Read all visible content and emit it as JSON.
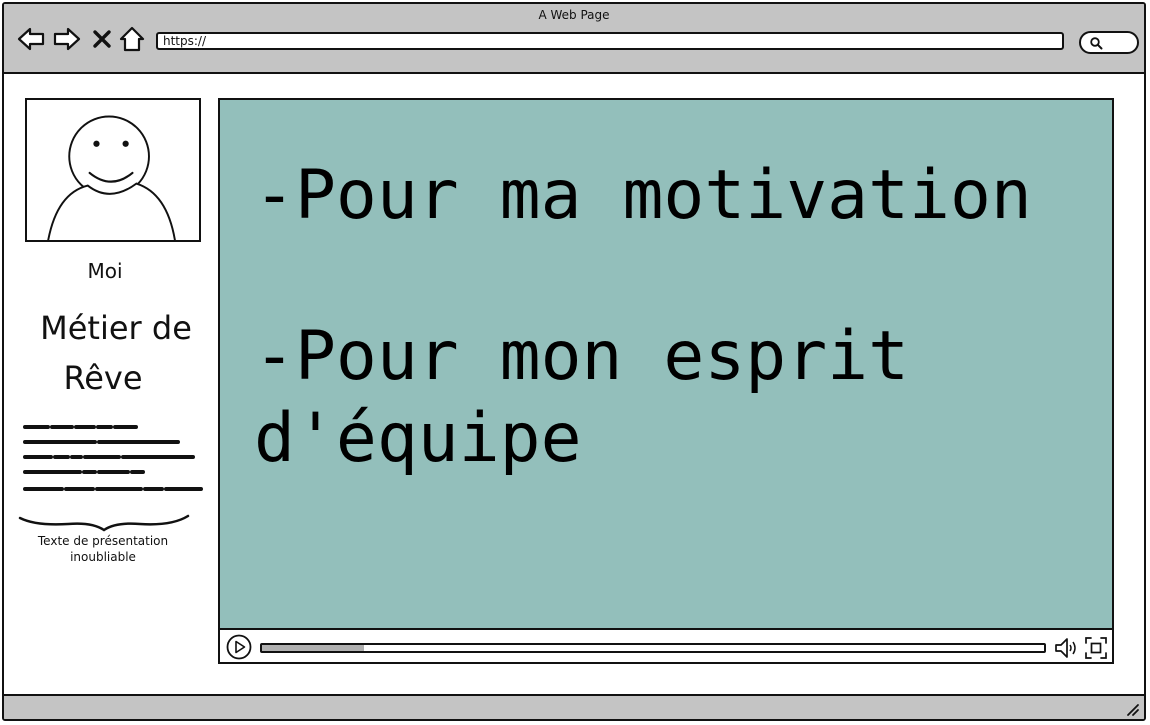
{
  "window": {
    "title": "A Web Page"
  },
  "browser": {
    "url": "https://",
    "icons": [
      "back-arrow-icon",
      "forward-arrow-icon",
      "close-icon",
      "home-icon",
      "search-icon"
    ]
  },
  "profile": {
    "name": "Moi",
    "job_title_line1": "Métier de",
    "job_title_line2": "Rêve",
    "caption_line1": "Texte de présentation",
    "caption_line2": "inoubliable"
  },
  "video": {
    "line1": "-Pour ma motivation",
    "line2": "-Pour mon esprit",
    "line3": "d'équipe",
    "progress": 0.13
  },
  "colors": {
    "chrome": "#c4c4c4",
    "video_background": "#93bfbb",
    "progress_fill": "#b0b0b0"
  }
}
